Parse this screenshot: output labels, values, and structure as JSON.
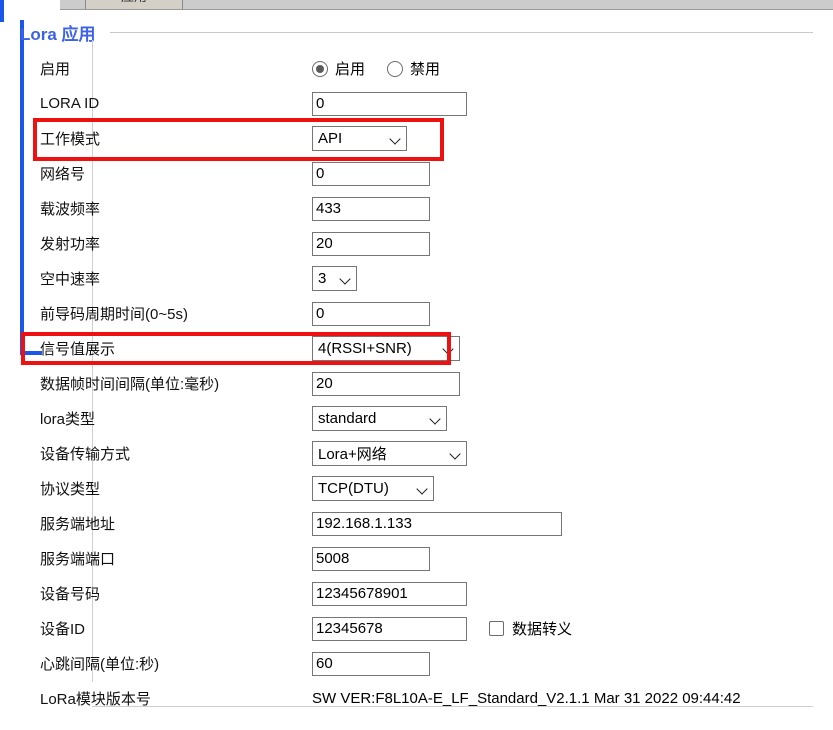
{
  "window": {
    "top_tab_fragment_label": "应用"
  },
  "section": {
    "title": "Lora 应用"
  },
  "form": {
    "enable": {
      "label": "启用",
      "options": [
        {
          "label": "启用",
          "selected": true
        },
        {
          "label": "禁用",
          "selected": false
        }
      ]
    },
    "rows": [
      {
        "label": "LORA ID",
        "type": "text",
        "value": "0"
      },
      {
        "label": "工作模式",
        "type": "select",
        "value": "API"
      },
      {
        "label": "网络号",
        "type": "text",
        "value": "0"
      },
      {
        "label": "载波频率",
        "type": "text",
        "value": "433"
      },
      {
        "label": "发射功率",
        "type": "text",
        "value": "20"
      },
      {
        "label": "空中速率",
        "type": "select",
        "value": "3"
      },
      {
        "label": "前导码周期时间(0~5s)",
        "type": "text",
        "value": "0"
      },
      {
        "label": "信号值展示",
        "type": "select",
        "value": "4(RSSI+SNR)"
      },
      {
        "label": "数据帧时间间隔(单位:毫秒)",
        "type": "text",
        "value": "20"
      },
      {
        "label": "lora类型",
        "type": "select",
        "value": "standard"
      },
      {
        "label": "设备传输方式",
        "type": "select",
        "value": "Lora+网络"
      },
      {
        "label": "协议类型",
        "type": "select",
        "value": "TCP(DTU)"
      },
      {
        "label": "服务端地址",
        "type": "text",
        "value": "192.168.1.133"
      },
      {
        "label": "服务端端口",
        "type": "text",
        "value": "5008"
      },
      {
        "label": "设备号码",
        "type": "text",
        "value": "12345678901"
      },
      {
        "label": "设备ID",
        "type": "text",
        "value": "12345678"
      },
      {
        "label": "心跳间隔(单位:秒)",
        "type": "text",
        "value": "60"
      },
      {
        "label": "LoRa模块版本号",
        "type": "static",
        "value": "SW VER:F8L10A-E_LF_Standard_V2.1.1 Mar 31 2022 09:44:42"
      }
    ],
    "data_escape": {
      "label": "数据转义",
      "checked": false
    }
  },
  "annotations": {
    "highlight_color": "#ee1111",
    "highlighted_rows": [
      "工作模式",
      "信号值展示"
    ]
  },
  "colors": {
    "heading": "#3b62e8",
    "panel_accent": "#1a56e8",
    "input_border": "#767676",
    "highlight": "#ee1111"
  }
}
